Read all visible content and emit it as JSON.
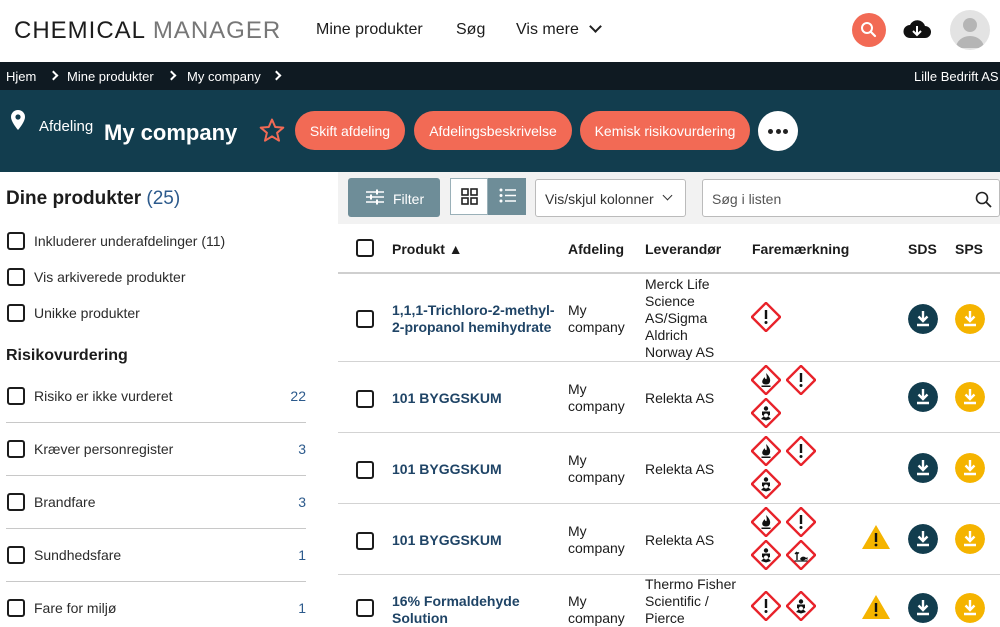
{
  "app": {
    "logo_part1": "CHEMICAL",
    "logo_part2": "MANAGER"
  },
  "nav": {
    "item1": "Mine produkter",
    "item2": "Søg",
    "item3": "Vis mere"
  },
  "breadcrumb": {
    "c1": "Hjem",
    "c2": "Mine produkter",
    "c3": "My company",
    "company": "Lille Bedrift AS"
  },
  "dept": {
    "label": "Afdeling",
    "name": "My company",
    "btn1": "Skift afdeling",
    "btn2": "Afdelingsbeskrivelse",
    "btn3": "Kemisk risikovurdering"
  },
  "sidebar": {
    "title": "Dine produkter",
    "count": "(25)",
    "opt1": "Inkluderer underafdelinger (11)",
    "opt2": "Vis arkiverede produkter",
    "opt3": "Unikke produkter",
    "section": "Risikovurdering",
    "risks": [
      {
        "label": "Risiko er ikke vurderet",
        "count": "22"
      },
      {
        "label": "Kræver personregister",
        "count": "3"
      },
      {
        "label": "Brandfare",
        "count": "3"
      },
      {
        "label": "Sundhedsfare",
        "count": "1"
      },
      {
        "label": "Fare for miljø",
        "count": "1"
      }
    ]
  },
  "toolbar": {
    "filter": "Filter",
    "columns": "Vis/skjul kolonner",
    "search_placeholder": "Søg i listen"
  },
  "table": {
    "headers": {
      "product": "Produkt ▲",
      "dept": "Afdeling",
      "supplier": "Leverandør",
      "hazard": "Faremærkning",
      "sds": "SDS",
      "sps": "SPS"
    },
    "rows": [
      {
        "product": [
          "1,1,1-Trichloro-2-methyl-",
          "2-propanol hemihydrate"
        ],
        "dept": [
          "My",
          "company"
        ],
        "supplier": [
          "Merck Life",
          "Science",
          "AS/Sigma",
          "Aldrich",
          "Norway AS"
        ],
        "hazards": [
          "exclamation"
        ],
        "warning": false
      },
      {
        "product": [
          "101 BYGGSKUM"
        ],
        "dept": [
          "My",
          "company"
        ],
        "supplier": [
          "Relekta AS"
        ],
        "hazards": [
          "flame",
          "exclamation",
          "health"
        ],
        "warning": false
      },
      {
        "product": [
          "101 BYGGSKUM"
        ],
        "dept": [
          "My",
          "company"
        ],
        "supplier": [
          "Relekta AS"
        ],
        "hazards": [
          "flame",
          "exclamation",
          "health"
        ],
        "warning": false
      },
      {
        "product": [
          "101 BYGGSKUM"
        ],
        "dept": [
          "My",
          "company"
        ],
        "supplier": [
          "Relekta AS"
        ],
        "hazards": [
          "flame",
          "exclamation",
          "health",
          "environment"
        ],
        "warning": true
      },
      {
        "product": [
          "16% Formaldehyde",
          "Solution"
        ],
        "dept": [
          "My",
          "company"
        ],
        "supplier": [
          "Thermo Fisher",
          "Scientific /",
          "Pierce"
        ],
        "hazards": [
          "exclamation",
          "health"
        ],
        "warning": true
      }
    ]
  },
  "colors": {
    "accent": "#f26a55",
    "dept_bar": "#123d4e",
    "crumb_bar": "#0f1a22",
    "download_sds": "#123d4e",
    "download_sps": "#f5b400",
    "link": "#1f4466"
  }
}
